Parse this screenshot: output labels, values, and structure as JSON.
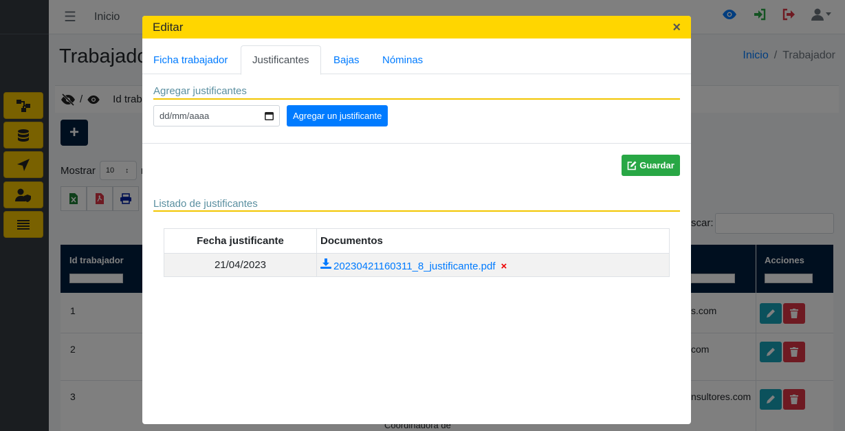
{
  "topbar": {
    "home_label": "Inicio"
  },
  "page": {
    "title": "Trabajador"
  },
  "breadcrumb": {
    "home": "Inicio",
    "separator": "/",
    "current": "Trabajador"
  },
  "filter_bar": {
    "separator": "/",
    "label": "Id traba"
  },
  "length_control": {
    "show_label": "Mostrar",
    "value": "10",
    "suffix": "r"
  },
  "search": {
    "label": "scar:"
  },
  "table": {
    "headers": {
      "id": "Id trabajador",
      "actions": "Acciones"
    },
    "rows": [
      {
        "id": "1",
        "email_fragment": "s.com"
      },
      {
        "id": "2",
        "email_fragment": "com"
      },
      {
        "id": "3",
        "email_fragment": "nsultores.com",
        "extra": "Coordinadora de"
      }
    ]
  },
  "modal": {
    "title": "Editar",
    "close": "×",
    "tabs": [
      {
        "label": "Ficha trabajador",
        "active": false
      },
      {
        "label": "Justificantes",
        "active": true
      },
      {
        "label": "Bajas",
        "active": false
      },
      {
        "label": "Nóminas",
        "active": false
      }
    ],
    "add_section": {
      "legend": "Agregar justificantes",
      "date_placeholder": "dd/mm/aaaa",
      "add_button": "Agregar un justificante"
    },
    "save_button": "Guardar",
    "list_section": {
      "legend": "Listado de justificantes",
      "headers": {
        "date": "Fecha justificante",
        "documents": "Documentos"
      },
      "rows": [
        {
          "date": "21/04/2023",
          "document": "20230421160311_8_justificante.pdf"
        }
      ],
      "delete_mark": "×"
    }
  },
  "colors": {
    "modal_header": "#ffd600",
    "primary": "#007bff",
    "success": "#28a745",
    "danger": "#dc3545",
    "navy": "#001f3f",
    "sidebar_button": "#f2c200"
  }
}
